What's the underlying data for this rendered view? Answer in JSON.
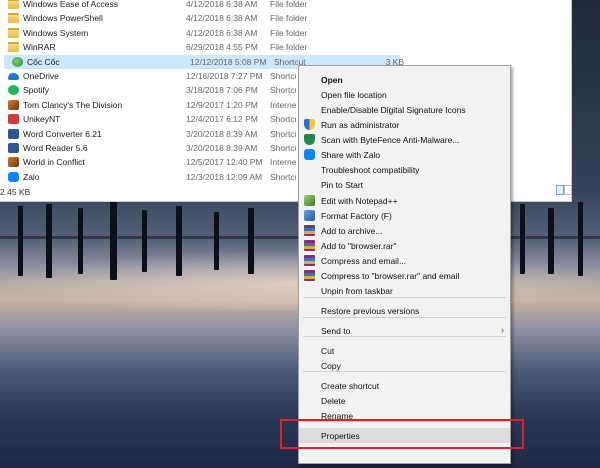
{
  "explorer": {
    "files": [
      {
        "name": "Windows Ease of Access",
        "date": "4/12/2018 6:38 AM",
        "type": "File folder",
        "size": "",
        "icon": "folder-icon"
      },
      {
        "name": "Windows PowerShell",
        "date": "4/12/2018 6:38 AM",
        "type": "File folder",
        "size": "",
        "icon": "folder-icon"
      },
      {
        "name": "Windows System",
        "date": "4/12/2018 6:38 AM",
        "type": "File folder",
        "size": "",
        "icon": "folder-icon"
      },
      {
        "name": "WinRAR",
        "date": "6/29/2018 4:55 PM",
        "type": "File folder",
        "size": "",
        "icon": "folder-icon"
      },
      {
        "name": "Cốc Cốc",
        "date": "12/12/2018 5:08 PM",
        "type": "Shortcut",
        "size": "3 KB",
        "icon": "coccoc-icon"
      },
      {
        "name": "OneDrive",
        "date": "12/16/2018 7:27 PM",
        "type": "Shortcut",
        "size": "",
        "icon": "onedrive-icon"
      },
      {
        "name": "Spotify",
        "date": "3/18/2018 7:06 PM",
        "type": "Shortcut",
        "size": "",
        "icon": "spotify-icon"
      },
      {
        "name": "Tom Clancy's The Division",
        "date": "12/9/2017 1:20 PM",
        "type": "Internet",
        "size": "",
        "icon": "game-icon"
      },
      {
        "name": "UnikeyNT",
        "date": "12/4/2017 6:12 PM",
        "type": "Shortcut",
        "size": "",
        "icon": "unikey-icon"
      },
      {
        "name": "Word Converter 6.21",
        "date": "3/20/2018 8:39 AM",
        "type": "Shortcut",
        "size": "",
        "icon": "word-icon"
      },
      {
        "name": "Word Reader 5.6",
        "date": "3/20/2018 8:39 AM",
        "type": "Shortcut",
        "size": "",
        "icon": "word-icon"
      },
      {
        "name": "World in Conflict",
        "date": "12/5/2017 12:40 PM",
        "type": "Internet",
        "size": "",
        "icon": "game-icon"
      },
      {
        "name": "Zalo",
        "date": "12/3/2018 12:09 AM",
        "type": "Shortcut",
        "size": "",
        "icon": "zalo-icon"
      }
    ],
    "status_size": "2.45 KB"
  },
  "context_menu": {
    "items": [
      {
        "label": "Open",
        "bold": true,
        "icon": ""
      },
      {
        "label": "Open file location",
        "icon": ""
      },
      {
        "label": "Enable/Disable Digital Signature Icons",
        "icon": ""
      },
      {
        "label": "Run as administrator",
        "icon": "shield-icon"
      },
      {
        "label": "Scan with ByteFence Anti-Malware...",
        "icon": "bytefence-icon"
      },
      {
        "label": "Share with Zalo",
        "icon": "zalo-icon"
      },
      {
        "label": "Troubleshoot compatibility",
        "icon": ""
      },
      {
        "label": "Pin to Start",
        "icon": ""
      },
      {
        "label": "Edit with Notepad++",
        "icon": "notepadpp-icon"
      },
      {
        "label": "Format Factory (F)",
        "icon": "formatfactory-icon"
      },
      {
        "label": "Add to archive...",
        "icon": "winrar-icon"
      },
      {
        "label": "Add to \"browser.rar\"",
        "icon": "winrar-icon"
      },
      {
        "label": "Compress and email...",
        "icon": "winrar-icon"
      },
      {
        "label": "Compress to \"browser.rar\" and email",
        "icon": "winrar-icon"
      },
      {
        "label": "Unpin from taskbar",
        "icon": ""
      },
      {
        "label": "Restore previous versions",
        "icon": ""
      },
      {
        "label": "Send to",
        "icon": "",
        "submenu": true
      },
      {
        "label": "Cut",
        "icon": ""
      },
      {
        "label": "Copy",
        "icon": ""
      },
      {
        "label": "Create shortcut",
        "icon": ""
      },
      {
        "label": "Delete",
        "icon": ""
      },
      {
        "label": "Rename",
        "icon": ""
      },
      {
        "label": "Properties",
        "icon": "",
        "highlighted": true
      }
    ],
    "chevron": "›"
  },
  "colors": {
    "selection": "#cce8ff",
    "highlight_box": "#e0202a",
    "menu_bg": "#f2f2f2"
  }
}
